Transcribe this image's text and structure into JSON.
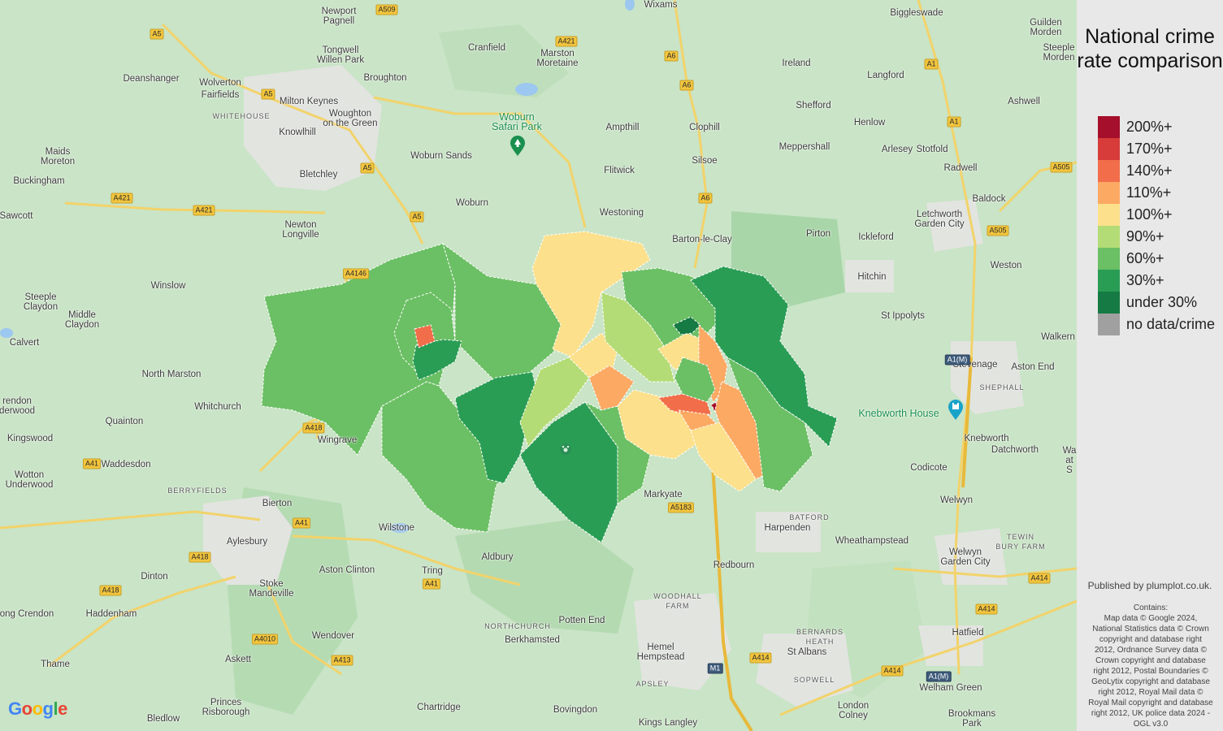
{
  "legend": {
    "title": "National crime rate comparison",
    "items": [
      {
        "label": "200%+",
        "color": "#a50f2b"
      },
      {
        "label": "170%+",
        "color": "#d73c3a"
      },
      {
        "label": "140%+",
        "color": "#f26d4a"
      },
      {
        "label": "110%+",
        "color": "#fca964"
      },
      {
        "label": "100%+",
        "color": "#fce08c"
      },
      {
        "label": "90%+",
        "color": "#b4dc76"
      },
      {
        "label": "60%+",
        "color": "#6bbf64"
      },
      {
        "label": "30%+",
        "color": "#2a9d55"
      },
      {
        "label": "under 30%",
        "color": "#157a43"
      },
      {
        "label": "no data/crime",
        "color": "#a0a0a0"
      }
    ]
  },
  "attribution": {
    "published": "Published by plumplot.co.uk.",
    "contains": "Contains:\nMap data © Google 2024,\nNational Statistics data © Crown\ncopyright and database right\n2012, Ordnance Survey data ©\nCrown copyright and database\nright 2012, Postal Boundaries ©\nGeoLytix copyright and database\nright 2012, Royal Mail data ©\nRoyal Mail copyright and database\nright 2012, UK police data 2024 -\nOGL v3.0"
  },
  "google_logo": {
    "letters": [
      "G",
      "o",
      "o",
      "g",
      "l",
      "e"
    ],
    "colors": [
      "#4285f4",
      "#ea4335",
      "#fbbc05",
      "#4285f4",
      "#34a853",
      "#ea4335"
    ]
  },
  "places": [
    {
      "name": "Newport\nPagnell"
    },
    {
      "name": "Wixams"
    },
    {
      "name": "Biggleswade"
    },
    {
      "name": "Guilden\nMorden"
    },
    {
      "name": "Wolverton"
    },
    {
      "name": "Tongwell\nWillen Park"
    },
    {
      "name": "Cranfield"
    },
    {
      "name": "Marston\nMoretaine"
    },
    {
      "name": "Steeple\nMorden"
    },
    {
      "name": "Ireland"
    },
    {
      "name": "Deanshanger"
    },
    {
      "name": "Broughton"
    },
    {
      "name": "Langford"
    },
    {
      "name": "Fairfields"
    },
    {
      "name": "Milton Keynes"
    },
    {
      "name": "Ashwell"
    },
    {
      "name": "WHITEHOUSE",
      "kind": "district"
    },
    {
      "name": "Woughton\non the Green"
    },
    {
      "name": "Shefford"
    },
    {
      "name": "Henlow"
    },
    {
      "name": "Knowlhill"
    },
    {
      "name": "Woburn\nSafari Park",
      "kind": "poi"
    },
    {
      "name": "Ampthill"
    },
    {
      "name": "Clophill"
    },
    {
      "name": "Maids\nMoreton"
    },
    {
      "name": "Arlesey"
    },
    {
      "name": "Stotfold"
    },
    {
      "name": "Woburn Sands"
    },
    {
      "name": "Meppershall"
    },
    {
      "name": "Bletchley"
    },
    {
      "name": "Buckingham"
    },
    {
      "name": "Silsoe"
    },
    {
      "name": "Radwell"
    },
    {
      "name": "Flitwick"
    },
    {
      "name": "Baldock"
    },
    {
      "name": "Woburn"
    },
    {
      "name": "Letchworth\nGarden City"
    },
    {
      "name": "Sawcott"
    },
    {
      "name": "Westoning"
    },
    {
      "name": "Newton\nLongville"
    },
    {
      "name": "Barton-le-Clay"
    },
    {
      "name": "Pirton"
    },
    {
      "name": "Ickleford"
    },
    {
      "name": "Weston"
    },
    {
      "name": "Winslow"
    },
    {
      "name": "Hitchin"
    },
    {
      "name": "Steeple\nClaydon"
    },
    {
      "name": "Middle\nClaydon"
    },
    {
      "name": "St Ippolyts"
    },
    {
      "name": "Walkern"
    },
    {
      "name": "Calvert"
    },
    {
      "name": "Stevenage"
    },
    {
      "name": "Aston End"
    },
    {
      "name": "North Marston"
    },
    {
      "name": "SHEPHALL",
      "kind": "district"
    },
    {
      "name": "Whitchurch"
    },
    {
      "name": "Knebworth House",
      "kind": "poi"
    },
    {
      "name": "Quainton"
    },
    {
      "name": "Knebworth"
    },
    {
      "name": "Datchworth"
    },
    {
      "name": "Wingrave"
    },
    {
      "name": "Codicote"
    },
    {
      "name": "Kingswood"
    },
    {
      "name": "Waddesdon"
    },
    {
      "name": "Wotton\nUnderwood"
    },
    {
      "name": "BERRYFIELDS",
      "kind": "district"
    },
    {
      "name": "Markyate"
    },
    {
      "name": "Welwyn"
    },
    {
      "name": "Bierton"
    },
    {
      "name": "BATFORD",
      "kind": "district"
    },
    {
      "name": "Harpenden"
    },
    {
      "name": "Wilstone"
    },
    {
      "name": "Wheathampstead"
    },
    {
      "name": "Aylesbury"
    },
    {
      "name": "Aldbury"
    },
    {
      "name": "TEWIN\nBURY FARM",
      "kind": "district"
    },
    {
      "name": "Welwyn\nGarden City"
    },
    {
      "name": "Redbourn"
    },
    {
      "name": "Aston Clinton"
    },
    {
      "name": "Tring"
    },
    {
      "name": "Dinton"
    },
    {
      "name": "Stoke\nMandeville"
    },
    {
      "name": "WOODHALL\nFARM",
      "kind": "district"
    },
    {
      "name": "Haddenham"
    },
    {
      "name": "Potten End"
    },
    {
      "name": "NORTHCHURCH",
      "kind": "district"
    },
    {
      "name": "Hatfield"
    },
    {
      "name": "BERNARDS\nHEATH",
      "kind": "district"
    },
    {
      "name": "Wendover"
    },
    {
      "name": "Berkhamsted"
    },
    {
      "name": "Hemel\nHempstead"
    },
    {
      "name": "St Albans"
    },
    {
      "name": "Thame"
    },
    {
      "name": "Askett"
    },
    {
      "name": "SOPWELL",
      "kind": "district"
    },
    {
      "name": "Welham Green"
    },
    {
      "name": "Princes\nRisborough"
    },
    {
      "name": "APSLEY",
      "kind": "district"
    },
    {
      "name": "London\nColney"
    },
    {
      "name": "Chartridge"
    },
    {
      "name": "Bovingdon"
    },
    {
      "name": "Brookmans\nPark"
    },
    {
      "name": "Bledlow"
    },
    {
      "name": "Kings Langley"
    },
    {
      "name": "ong Crendon"
    },
    {
      "name": "rendon\nderwood"
    },
    {
      "name": "Wa\nat S"
    },
    {
      "name": "Wilstone"
    }
  ],
  "roads": [
    {
      "ref": "A509"
    },
    {
      "ref": "A5"
    },
    {
      "ref": "A421"
    },
    {
      "ref": "A6"
    },
    {
      "ref": "A1"
    },
    {
      "ref": "A5"
    },
    {
      "ref": "A6"
    },
    {
      "ref": "A1"
    },
    {
      "ref": "A5"
    },
    {
      "ref": "A421"
    },
    {
      "ref": "A421"
    },
    {
      "ref": "A5"
    },
    {
      "ref": "A6"
    },
    {
      "ref": "A505"
    },
    {
      "ref": "A505"
    },
    {
      "ref": "A4146"
    },
    {
      "ref": "A1(M)",
      "kind": "motorway"
    },
    {
      "ref": "A418"
    },
    {
      "ref": "A41"
    },
    {
      "ref": "A5183"
    },
    {
      "ref": "A41"
    },
    {
      "ref": "A418"
    },
    {
      "ref": "A41"
    },
    {
      "ref": "A418"
    },
    {
      "ref": "A414"
    },
    {
      "ref": "A414"
    },
    {
      "ref": "A4010"
    },
    {
      "ref": "M1",
      "kind": "motorway"
    },
    {
      "ref": "A413"
    },
    {
      "ref": "A414"
    },
    {
      "ref": "A414"
    },
    {
      "ref": "A1(M)",
      "kind": "motorway"
    }
  ]
}
